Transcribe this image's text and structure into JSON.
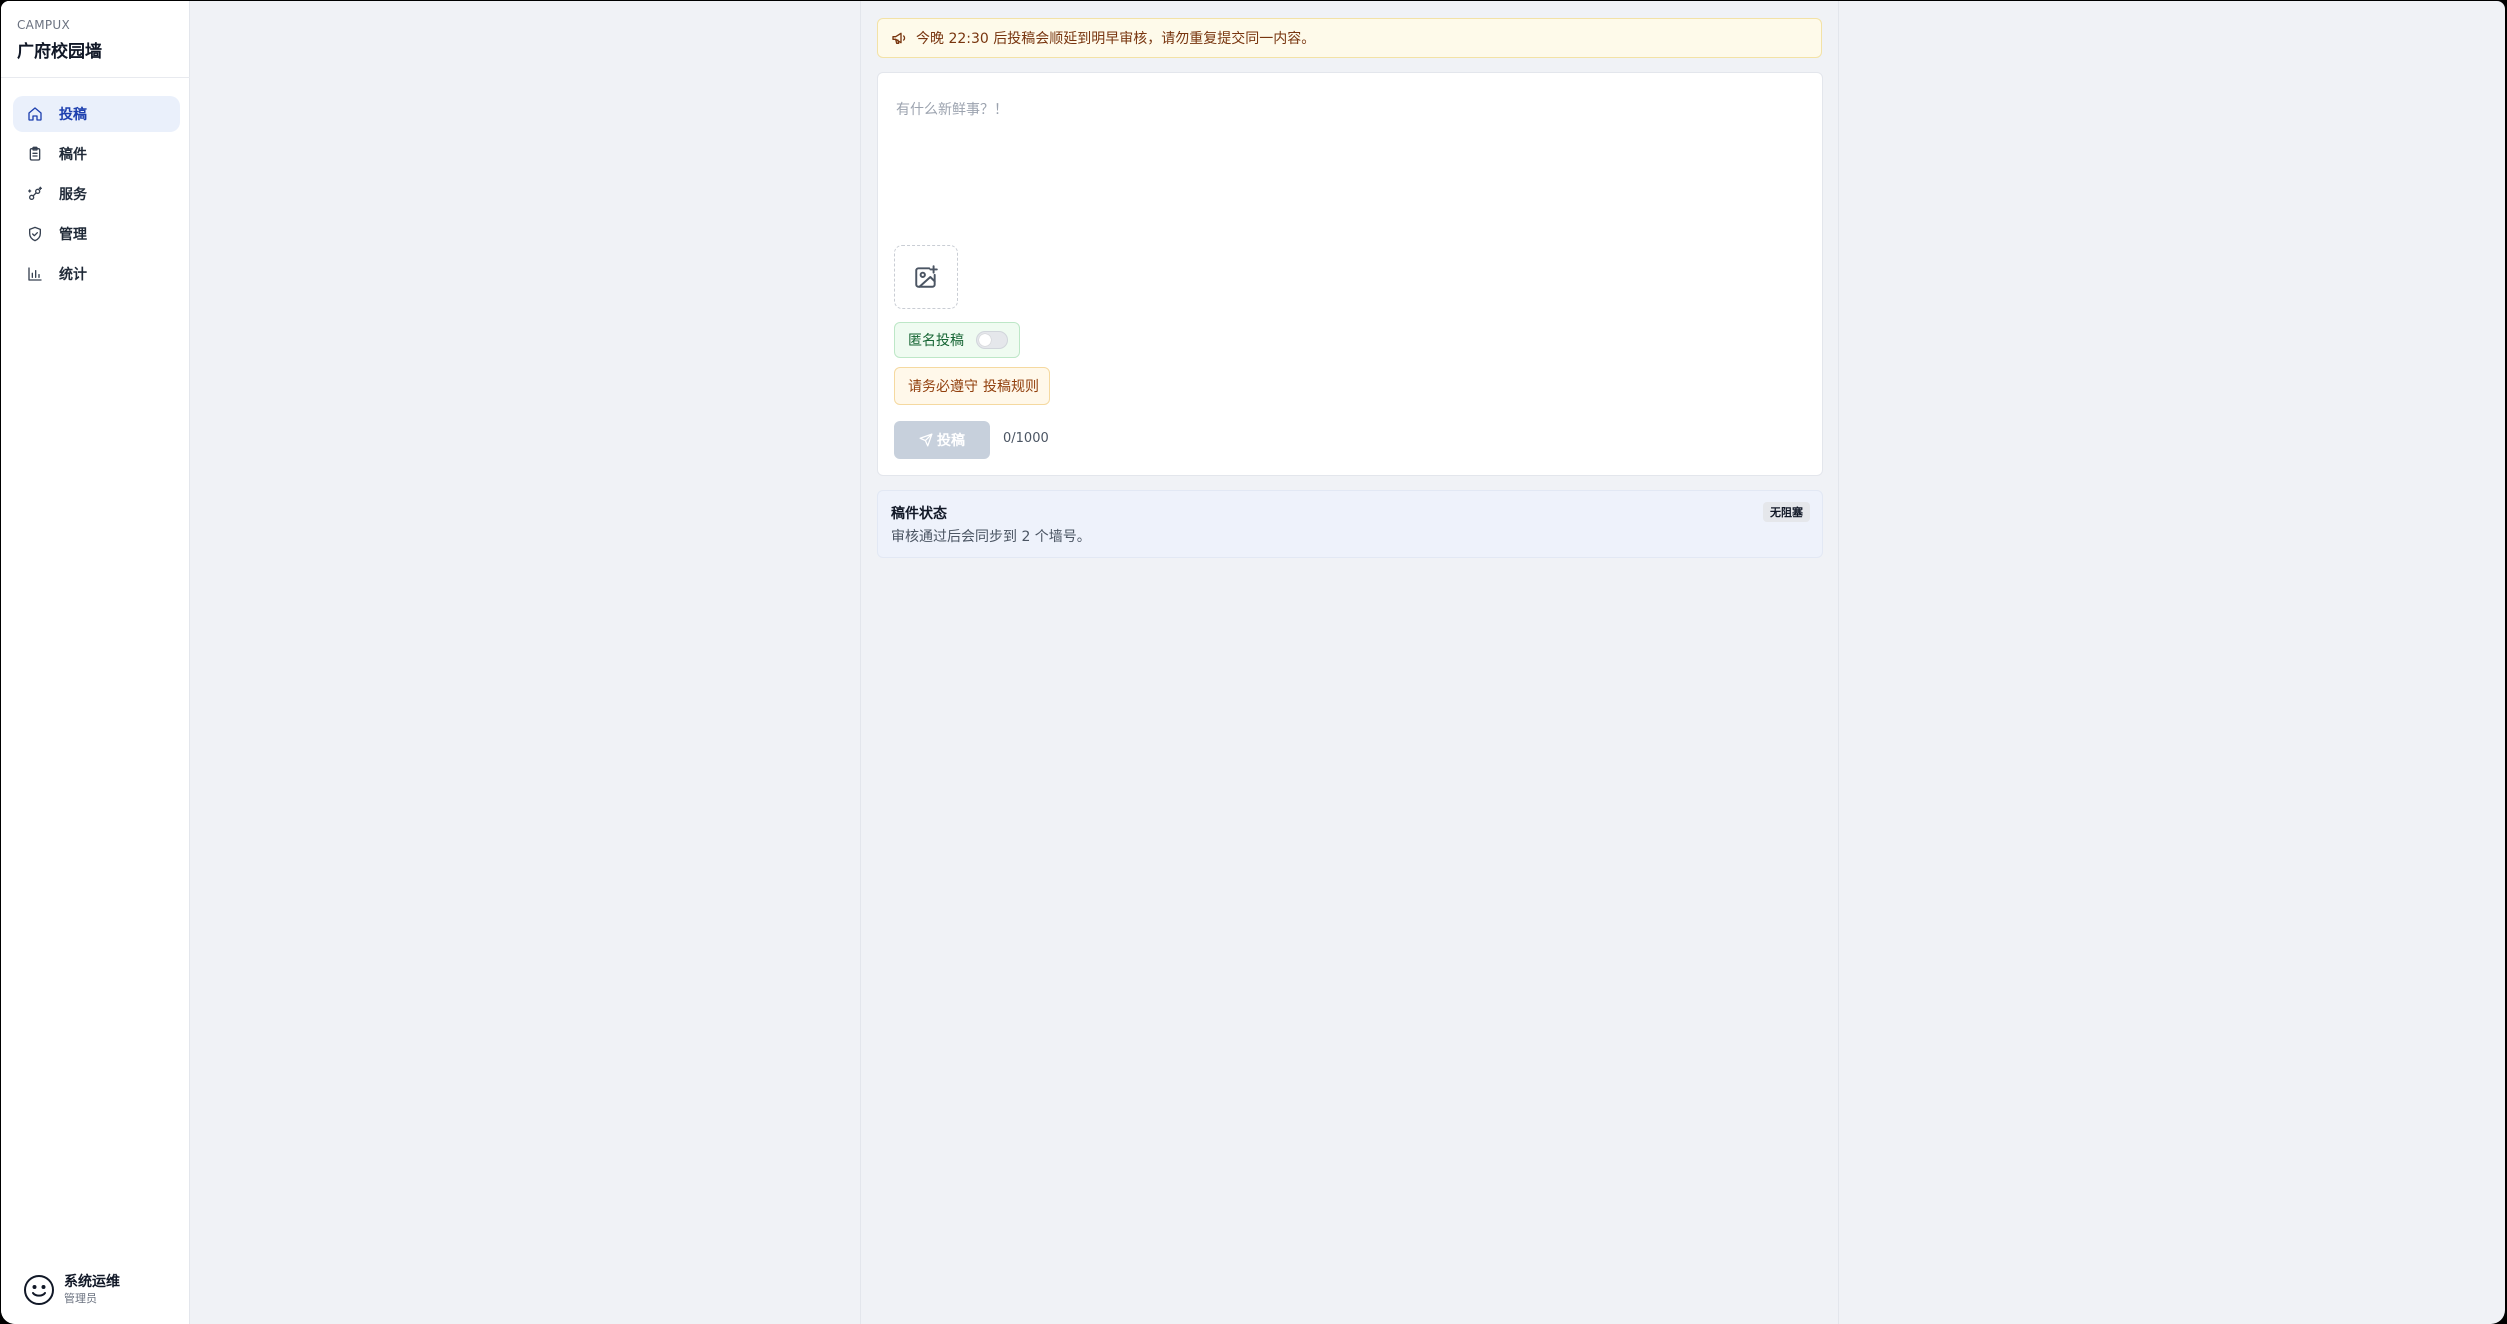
{
  "brand": {
    "small": "CAMPUX",
    "title": "广府校园墙"
  },
  "nav": {
    "items": [
      {
        "label": "投稿",
        "icon": "home-icon",
        "active": true
      },
      {
        "label": "稿件",
        "icon": "clipboard-icon",
        "active": false
      },
      {
        "label": "服务",
        "icon": "service-icon",
        "active": false
      },
      {
        "label": "管理",
        "icon": "shield-check-icon",
        "active": false
      },
      {
        "label": "统计",
        "icon": "bar-chart-icon",
        "active": false
      }
    ]
  },
  "user": {
    "name": "系统运维",
    "role": "管理员",
    "avatar_icon": "smiley-icon"
  },
  "notice": {
    "icon": "megaphone-icon",
    "text": "今晚 22:30 后投稿会顺延到明早审核，请勿重复提交同一内容。"
  },
  "composer": {
    "placeholder": "有什么新鲜事？！",
    "image_add_icon": "image-plus-icon",
    "anonymous_label": "匿名投稿",
    "anonymous_on": false,
    "rules_text": "请务必遵守",
    "rules_link": "投稿规则",
    "submit_label": "投稿",
    "submit_icon": "send-icon",
    "counter": "0/1000"
  },
  "status": {
    "title": "稿件状态",
    "description": "审核通过后会同步到 2 个墙号。",
    "badge": "无阻塞"
  },
  "colors": {
    "accent": "#1e40af",
    "active_nav_bg": "#eaf0fb",
    "notice_bg": "#fefaea",
    "anon_bg": "#effbf1",
    "rules_bg": "#fff8ea",
    "submit_disabled": "#c7d0dc",
    "page_bg": "#f0f2f6"
  }
}
